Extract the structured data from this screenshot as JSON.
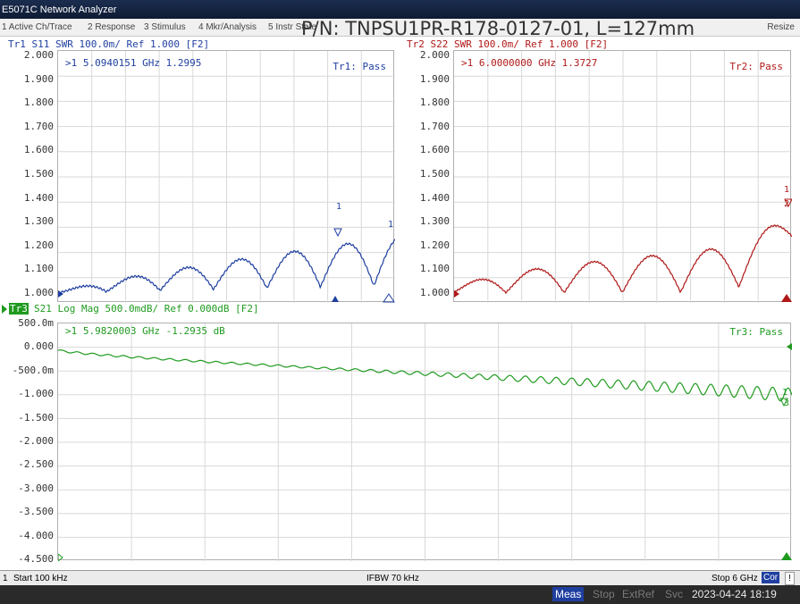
{
  "window": {
    "title": "E5071C Network Analyzer"
  },
  "menu": {
    "items": [
      {
        "label": "1 Active Ch/Trace"
      },
      {
        "label": "2 Response"
      },
      {
        "label": "3 Stimulus"
      },
      {
        "label": "4 Mkr/Analysis"
      },
      {
        "label": "5 Instr State"
      }
    ],
    "resize": "Resize"
  },
  "overlay_text": "P/N: TNPSU1PR-R178-0127-01, L=127mm",
  "trace1": {
    "header": "Tr1 S11 SWR 100.0m/ Ref 1.000 [F2]",
    "color": "#1f3fa0",
    "marker_readout": ">1  5.0940151 GHz  1.2995",
    "pass": "Tr1: Pass",
    "yticks": [
      "2.000",
      "1.900",
      "1.800",
      "1.700",
      "1.600",
      "1.500",
      "1.400",
      "1.300",
      "1.200",
      "1.100",
      "1.000"
    ],
    "marker_num": "1",
    "end_label": "1"
  },
  "trace2": {
    "header": "Tr2 S22 SWR 100.0m/ Ref 1.000 [F2]",
    "color": "#b01818",
    "marker_readout": ">1  6.0000000 GHz  1.3727",
    "pass": "Tr2: Pass",
    "yticks": [
      "2.000",
      "1.900",
      "1.800",
      "1.700",
      "1.600",
      "1.500",
      "1.400",
      "1.300",
      "1.200",
      "1.100",
      "1.000"
    ],
    "marker_num": "1",
    "end_label": "2"
  },
  "trace3": {
    "badge": "Tr3",
    "header": "S21 Log Mag 500.0mdB/ Ref 0.000dB [F2]",
    "color": "#1f9a1f",
    "marker_readout": ">1  5.9820003 GHz -1.2935 dB",
    "pass": "Tr3: Pass",
    "yticks": [
      "500.0m",
      "0.000",
      "-500.0m",
      "-1.000",
      "-1.500",
      "-2.000",
      "-2.500",
      "-3.000",
      "-3.500",
      "-4.000",
      "-4.500"
    ],
    "marker_num": "1",
    "end_label": "3"
  },
  "status": {
    "channel": "1",
    "start": "Start 100 kHz",
    "ifbw": "IFBW 70 kHz",
    "stop": "Stop 6 GHz",
    "cor": "Cor",
    "excl": "!"
  },
  "bottom": {
    "meas": "Meas",
    "stop": "Stop",
    "extref": "ExtRef",
    "svc": "Svc",
    "datetime": "2023-04-24 18:19"
  }
}
